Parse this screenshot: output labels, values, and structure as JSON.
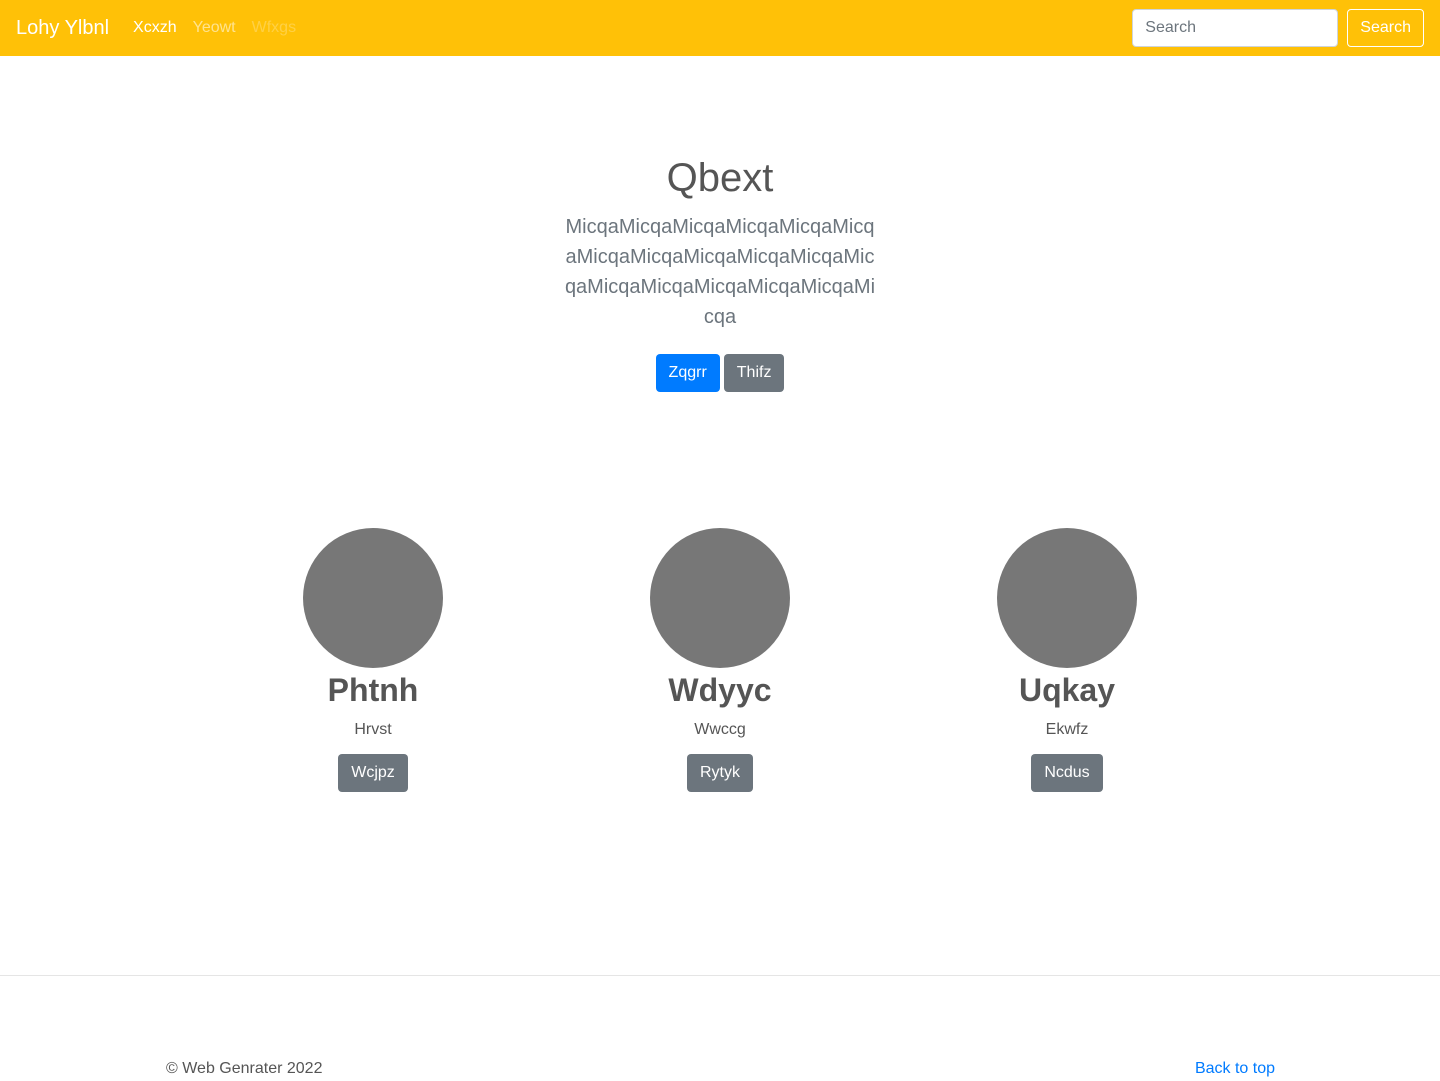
{
  "navbar": {
    "brand": "Lohy Ylbnl",
    "links": [
      {
        "label": "Xcxzh",
        "state": "active"
      },
      {
        "label": "Yeowt",
        "state": "normal"
      },
      {
        "label": "Wfxgs",
        "state": "disabled"
      }
    ],
    "search": {
      "placeholder": "Search",
      "button_label": "Search"
    },
    "background_color": "#ffc107"
  },
  "hero": {
    "title": "Qbext",
    "lead": "MicqaMicqaMicqaMicqaMicqaMicqaMicqaMicqaMicqaMicqaMicqaMicqaMicqaMicqaMicqaMicqaMicqaMicqa",
    "primary_button": "Zqgrr",
    "secondary_button": "Thifz"
  },
  "columns": [
    {
      "name": "Phtnh",
      "subtitle": "Hrvst",
      "button": "Wcjpz"
    },
    {
      "name": "Wdyyc",
      "subtitle": "Wwccg",
      "button": "Rytyk"
    },
    {
      "name": "Uqkay",
      "subtitle": "Ekwfz",
      "button": "Ncdus"
    }
  ],
  "footer": {
    "copyright": "© Web Genrater 2022",
    "back_to_top": "Back to top"
  }
}
